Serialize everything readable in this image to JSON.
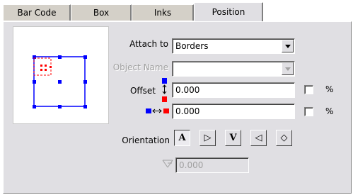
{
  "tabs": [
    {
      "label": "Bar Code"
    },
    {
      "label": "Box"
    },
    {
      "label": "Inks"
    },
    {
      "label": "Position"
    }
  ],
  "attach_to": {
    "label": "Attach to",
    "value": "Borders"
  },
  "object_name": {
    "label": "Object Name",
    "value": ""
  },
  "offset_vertical": {
    "label": "Offset",
    "value": "0.000",
    "percent_label": "%",
    "percent_checked": false
  },
  "offset_horizontal": {
    "value": "0.000",
    "percent_label": "%",
    "percent_checked": false
  },
  "orientation": {
    "label": "Orientation",
    "buttons": [
      {
        "glyph": "A",
        "name": "orientation-0",
        "pressed": true
      },
      {
        "glyph": "▷",
        "name": "orientation-90"
      },
      {
        "glyph": "V",
        "name": "orientation-180"
      },
      {
        "glyph": "◁",
        "name": "orientation-270"
      },
      {
        "glyph": "◇",
        "name": "orientation-free"
      }
    ]
  },
  "angle": {
    "value": "0.000"
  },
  "colors": {
    "blue": "#0000ff",
    "red": "#ff0000",
    "panel": "#e0dfe3"
  },
  "icons": [
    "vertical-offset-icon",
    "horizontal-offset-icon",
    "angle-icon"
  ]
}
